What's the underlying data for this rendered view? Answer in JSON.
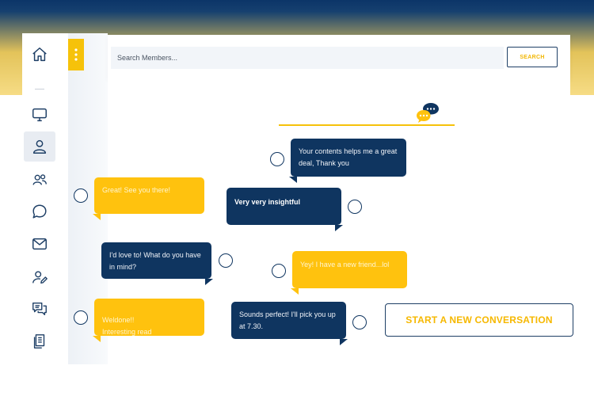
{
  "search": {
    "placeholder": "Search Members...",
    "button_label": "SEARCH"
  },
  "sidebar": {
    "items": [
      {
        "icon": "home-icon"
      },
      {
        "icon": "monitor-icon"
      },
      {
        "icon": "user-icon",
        "active": true
      },
      {
        "icon": "users-icon"
      },
      {
        "icon": "chat-bubble-icon"
      },
      {
        "icon": "mail-icon"
      },
      {
        "icon": "user-edit-icon"
      },
      {
        "icon": "conversations-icon"
      },
      {
        "icon": "documents-icon"
      }
    ]
  },
  "messages": [
    {
      "text": "Your contents helps me a great deal, Thank you",
      "style": "navy"
    },
    {
      "text": "Great! See you there!",
      "style": "yellow"
    },
    {
      "text": "Very very insightful",
      "style": "navy"
    },
    {
      "text": "I'd love to! What do you have in mind?",
      "style": "navy"
    },
    {
      "text": "Yey! I have a new friend...lol",
      "style": "yellow"
    },
    {
      "text": "Weldone!!\nInteresting read",
      "style": "yellow"
    },
    {
      "text": "Sounds perfect! I'll pick you up at 7.30.",
      "style": "navy"
    }
  ],
  "cta": {
    "label": "START A NEW CONVERSATION"
  },
  "colors": {
    "navy": "#0f3560",
    "yellow": "#ffc20e",
    "accent": "#f6c20a"
  }
}
